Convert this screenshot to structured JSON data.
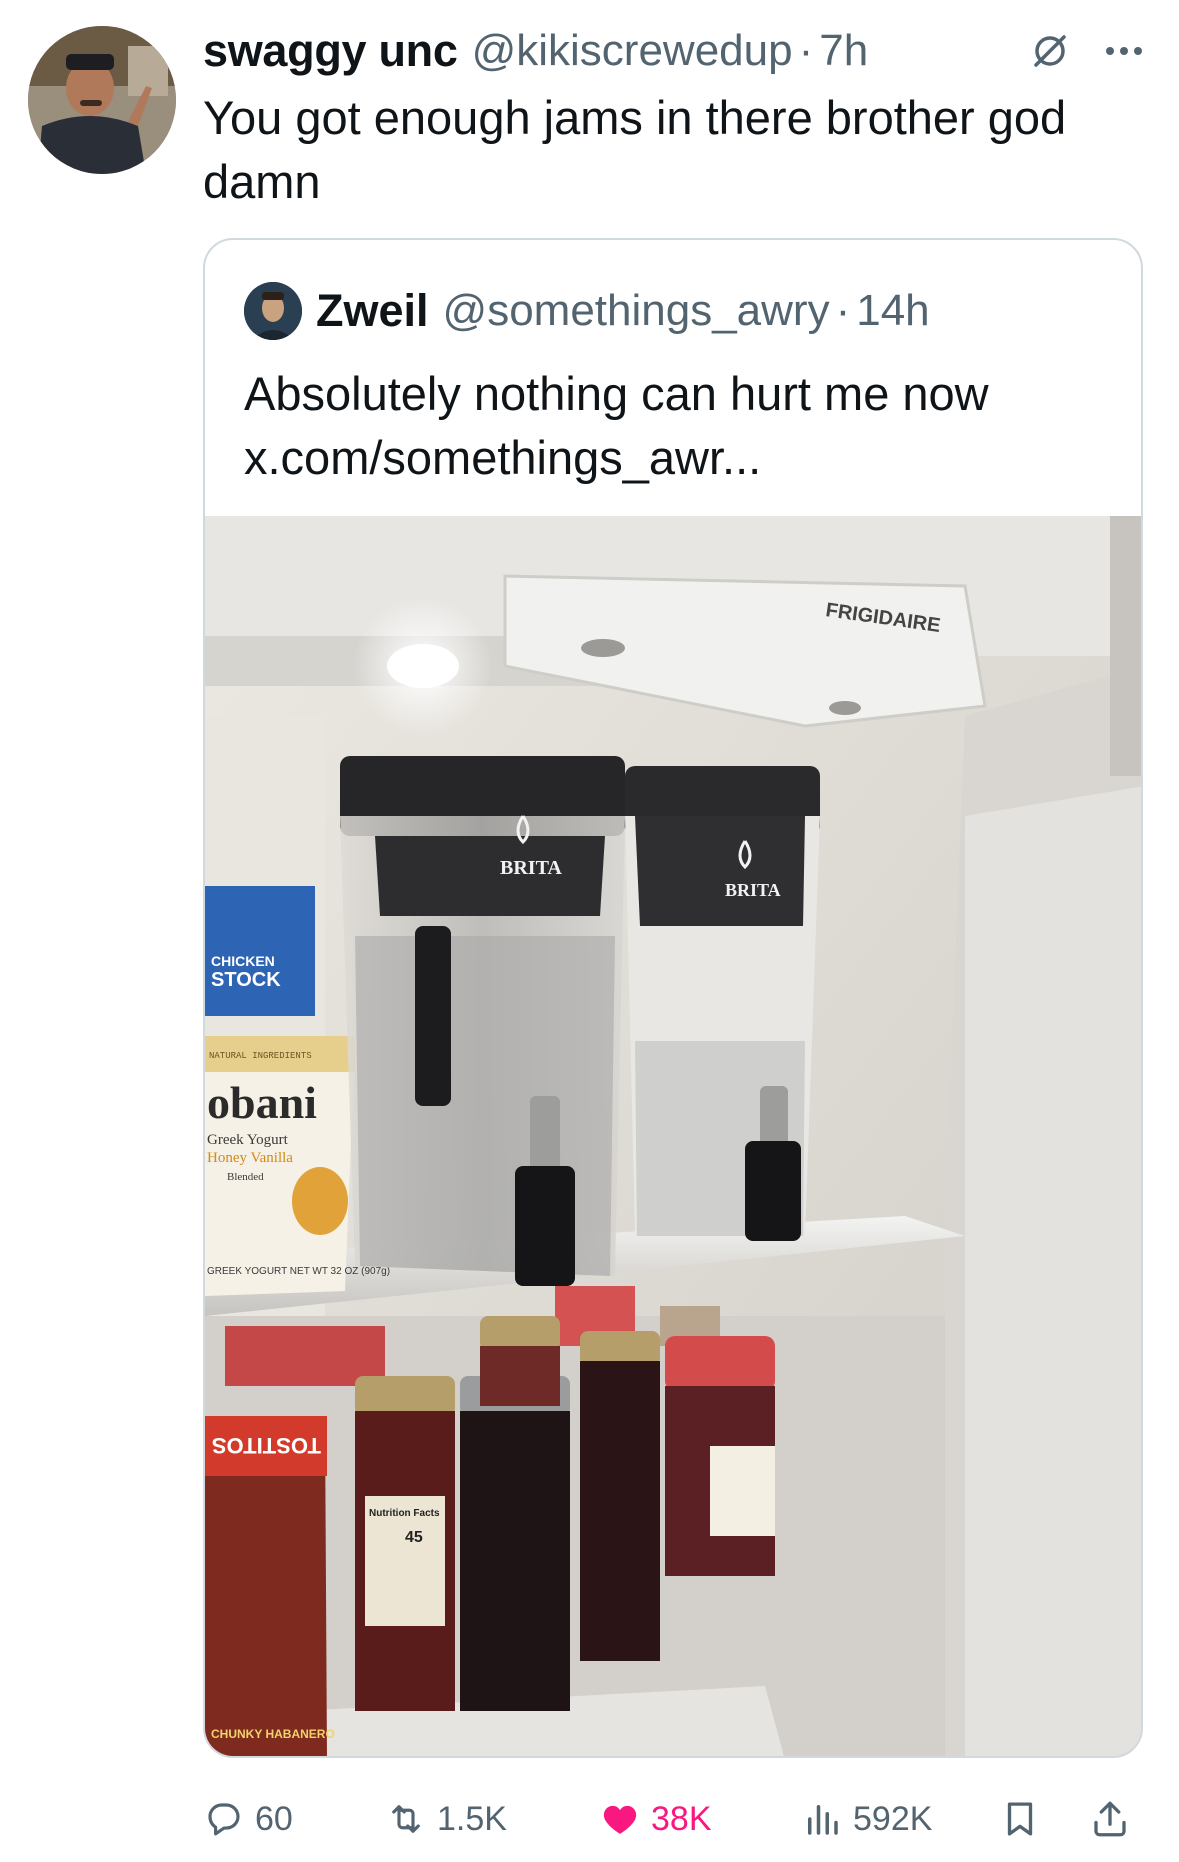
{
  "tweet": {
    "display_name": "swaggy unc",
    "handle": "@kikiscrewedup",
    "separator": "·",
    "time": "7h",
    "text": "You got enough jams in there brother god damn"
  },
  "quoted_tweet": {
    "display_name": "Zweil",
    "handle": "@somethings_awry",
    "separator": "·",
    "time": "14h",
    "text_line1": "Absolutely nothing can hurt me now",
    "text_line2": "x.com/somethings_awr...",
    "image": {
      "fridge_brand": "FRIGIDAIRE",
      "dispenser_left_brand": "BRITA",
      "dispenser_right_brand": "BRITA",
      "carton_label_line1": "CHICKEN",
      "carton_label_line2": "STOCK",
      "yogurt_brand": "obani",
      "yogurt_line1": "Greek Yogurt",
      "yogurt_line2": "Honey Vanilla",
      "yogurt_line3": "Blended",
      "yogurt_band": "NATURAL INGREDIENTS",
      "yogurt_bottom": "GREEK YOGURT  NET WT 32 OZ (907g)",
      "salsa_brand": "TOSTITOS",
      "salsa_flavor": "CHUNKY HABANERO",
      "jar_label": "Nutrition Facts",
      "jar_calories": "45"
    }
  },
  "actions": {
    "replies": "60",
    "reposts": "1.5K",
    "likes": "38K",
    "views": "592K"
  },
  "colors": {
    "text_primary": "#0f1419",
    "text_secondary": "#536471",
    "like_pink": "#f91880",
    "border": "#cfd9de"
  },
  "icons": [
    "grok-icon",
    "more-icon",
    "reply-icon",
    "retweet-icon",
    "heart-icon",
    "views-icon",
    "bookmark-icon",
    "share-icon"
  ]
}
